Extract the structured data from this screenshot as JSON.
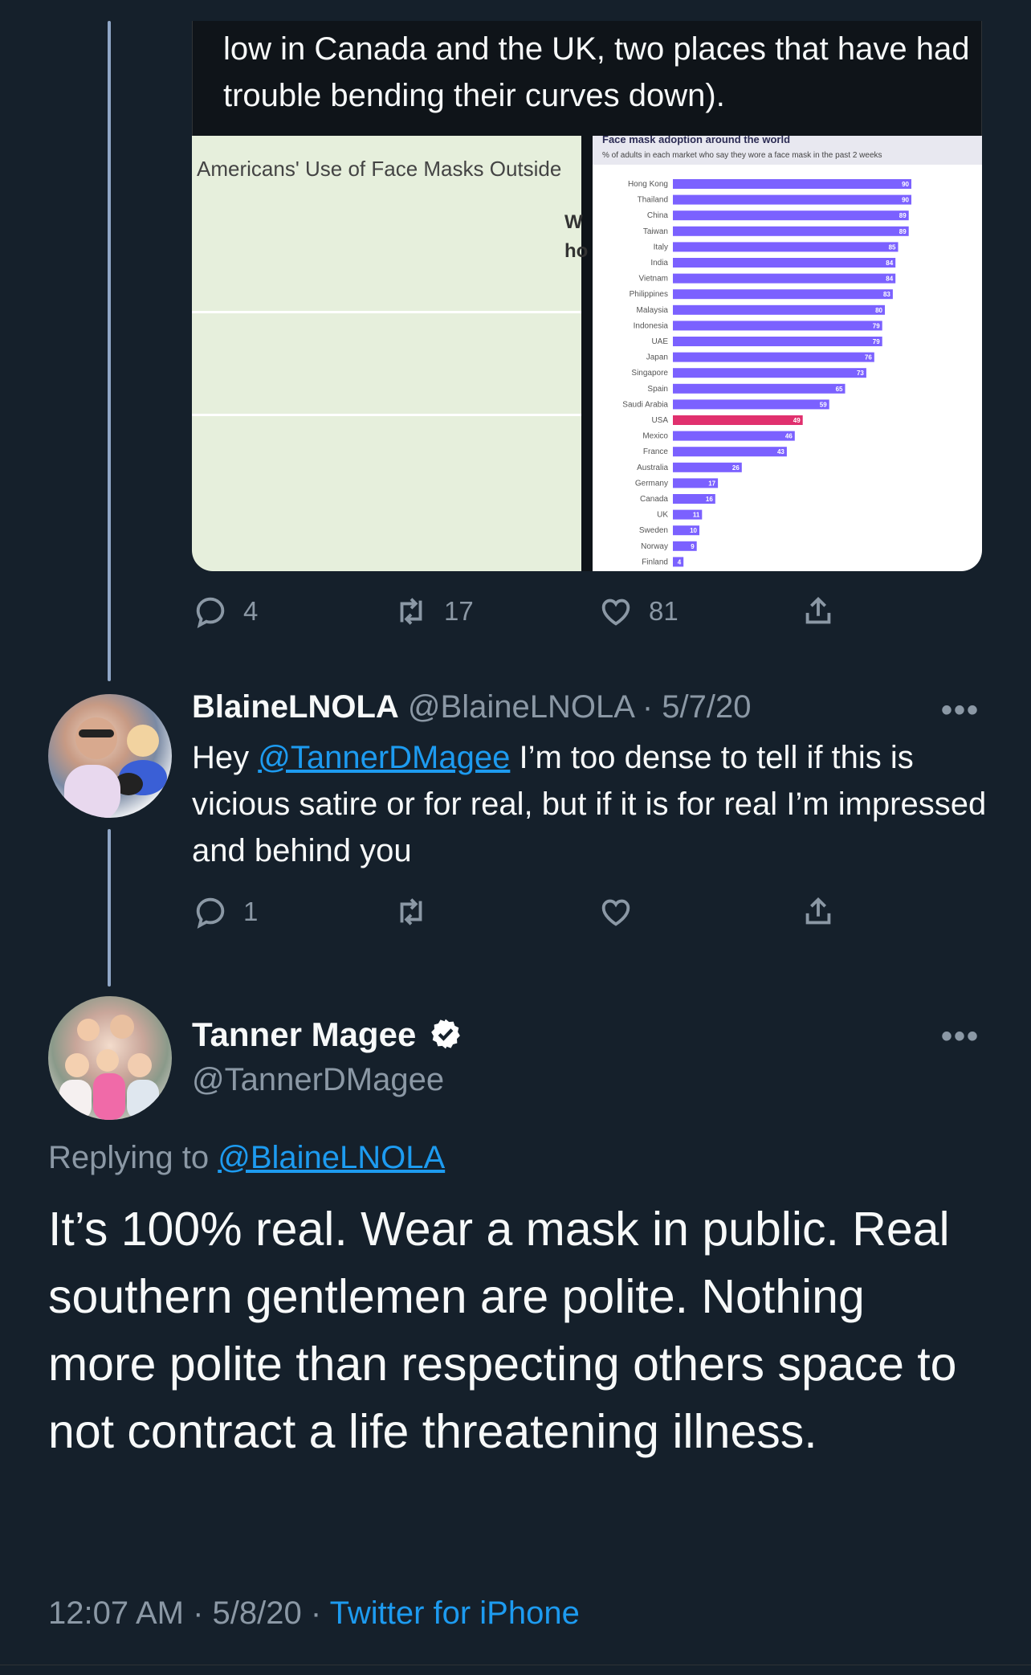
{
  "quoted_card": {
    "text": "low in Canada and the UK, two places that have had trouble bending their curves down).",
    "left_image": {
      "title": "Americans' Use of Face Masks Outside",
      "cut_text_1": "W",
      "cut_text_2": "ho"
    },
    "right_image": {
      "title": "Face mask adoption around the world",
      "subtitle": "% of adults in each market who say they wore a face mask in the past 2 weeks"
    }
  },
  "chart_data": {
    "type": "bar",
    "title": "Face mask adoption around the world",
    "subtitle": "% of adults in each market who say they wore a face mask in the past 2 weeks",
    "orientation": "horizontal",
    "categories": [
      "Hong Kong",
      "Thailand",
      "China",
      "Taiwan",
      "Italy",
      "India",
      "Vietnam",
      "Philippines",
      "Malaysia",
      "Indonesia",
      "UAE",
      "Japan",
      "Singapore",
      "Spain",
      "Saudi Arabia",
      "USA",
      "Mexico",
      "France",
      "Australia",
      "Germany",
      "Canada",
      "UK",
      "Sweden",
      "Norway",
      "Finland"
    ],
    "values": [
      90,
      90,
      89,
      89,
      85,
      84,
      84,
      83,
      80,
      79,
      79,
      76,
      73,
      65,
      59,
      49,
      46,
      43,
      26,
      17,
      16,
      11,
      10,
      9,
      4
    ],
    "highlight": "USA",
    "colors": {
      "bar": "#7b61ff",
      "highlight": "#e0306e"
    },
    "xlim": [
      0,
      100
    ]
  },
  "first_tweet_actions": {
    "reply_count": "4",
    "retweet_count": "17",
    "like_count": "81"
  },
  "reply_tweet": {
    "name": "BlaineLNOLA",
    "handle": "@BlaineLNOLA",
    "date": "· 5/7/20",
    "more": "•••",
    "text_before": "Hey ",
    "mention": "@TannerDMagee",
    "text_after": " I’m too dense to tell if this is vicious satire or for real, but if it is for real I’m impressed and behind you",
    "reply_count": "1",
    "retweet_count": "",
    "like_count": ""
  },
  "main_tweet": {
    "name": "Tanner Magee",
    "handle": "@TannerDMagee",
    "verified_icon": "verified-badge-icon",
    "more": "•••",
    "replying_prefix": "Replying to ",
    "replying_to": "@BlaineLNOLA",
    "text": "It’s 100% real. Wear a mask in public. Real southern gentlemen are polite. Nothing more polite than respecting others space to not contract a life threatening illness.",
    "time": "12:07 AM · 5/8/20 · ",
    "source": "Twitter for iPhone"
  },
  "icons": [
    "reply-icon",
    "retweet-icon",
    "like-icon",
    "share-icon",
    "verified-badge-icon"
  ],
  "colors": {
    "background": "#15202b",
    "accent": "#1d9bf0",
    "muted": "#8b98a5",
    "thread_line": "#8fa6c6"
  }
}
